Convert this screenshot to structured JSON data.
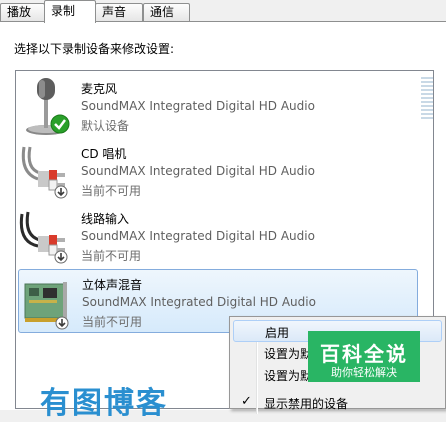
{
  "tabs": [
    {
      "label": "播放"
    },
    {
      "label": "录制"
    },
    {
      "label": "声音"
    },
    {
      "label": "通信"
    }
  ],
  "prompt": "选择以下录制设备来修改设置:",
  "devices": [
    {
      "name": "麦克风",
      "driver": "SoundMAX Integrated Digital HD Audio",
      "status": "默认设备",
      "icon": "microphone-icon",
      "badge": "default-check"
    },
    {
      "name": "CD 唱机",
      "driver": "SoundMAX Integrated Digital HD Audio",
      "status": "当前不可用",
      "icon": "rca-cable-icon",
      "badge": "unavailable-arrow"
    },
    {
      "name": "线路输入",
      "driver": "SoundMAX Integrated Digital HD Audio",
      "status": "当前不可用",
      "icon": "rca-cable-icon",
      "badge": "unavailable-arrow"
    },
    {
      "name": "立体声混音",
      "driver": "SoundMAX Integrated Digital HD Audio",
      "status": "当前不可用",
      "icon": "sound-card-icon",
      "badge": "unavailable-arrow",
      "selected": true
    }
  ],
  "context_menu": {
    "items": [
      {
        "label": "启用",
        "highlighted": true
      },
      {
        "label": "设置为默"
      },
      {
        "label": "设置为默"
      },
      {
        "label": "显示禁用的设备",
        "checked": true
      }
    ]
  },
  "watermark": {
    "title": "百科全说",
    "subtitle": "助你轻松解决"
  },
  "blog_watermark": "有图博客",
  "colors": {
    "selection_border": "#84acdd",
    "watermark_green": "#29b564",
    "blog_blue": "#2a8fd0",
    "check_green": "#2aa02a"
  }
}
